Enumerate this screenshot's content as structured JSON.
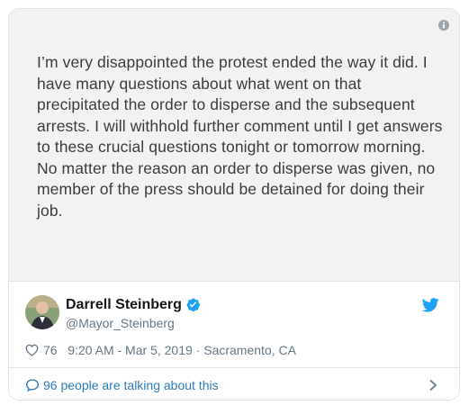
{
  "tweet": {
    "text": "I’m very disappointed the protest ended the way it did. I have many questions about what went on that precipitated the order to disperse and the subsequent arrests. I will withhold further comment until I get answers to these crucial questions tonight or tomorrow morning. No matter the reason an order to disperse was given, no member of the press should be detained for doing their job.",
    "author": {
      "name": "Darrell Steinberg",
      "handle": "@Mayor_Steinberg",
      "verified": true
    },
    "likes": "76",
    "time": "9:20 AM - Mar 5, 2019",
    "separator": " · ",
    "location": "Sacramento, CA",
    "talking": "96 people are talking about this"
  },
  "icons": {
    "info": "info-icon",
    "verified": "verified-badge-icon",
    "brand": "twitter-bird-icon",
    "like": "heart-icon",
    "reply": "speech-bubble-icon",
    "chevron": "chevron-right-icon"
  },
  "colors": {
    "accent": "#1da1f2",
    "link": "#2b7bb9",
    "muted": "#657786",
    "panel": "#f2f2f2"
  }
}
